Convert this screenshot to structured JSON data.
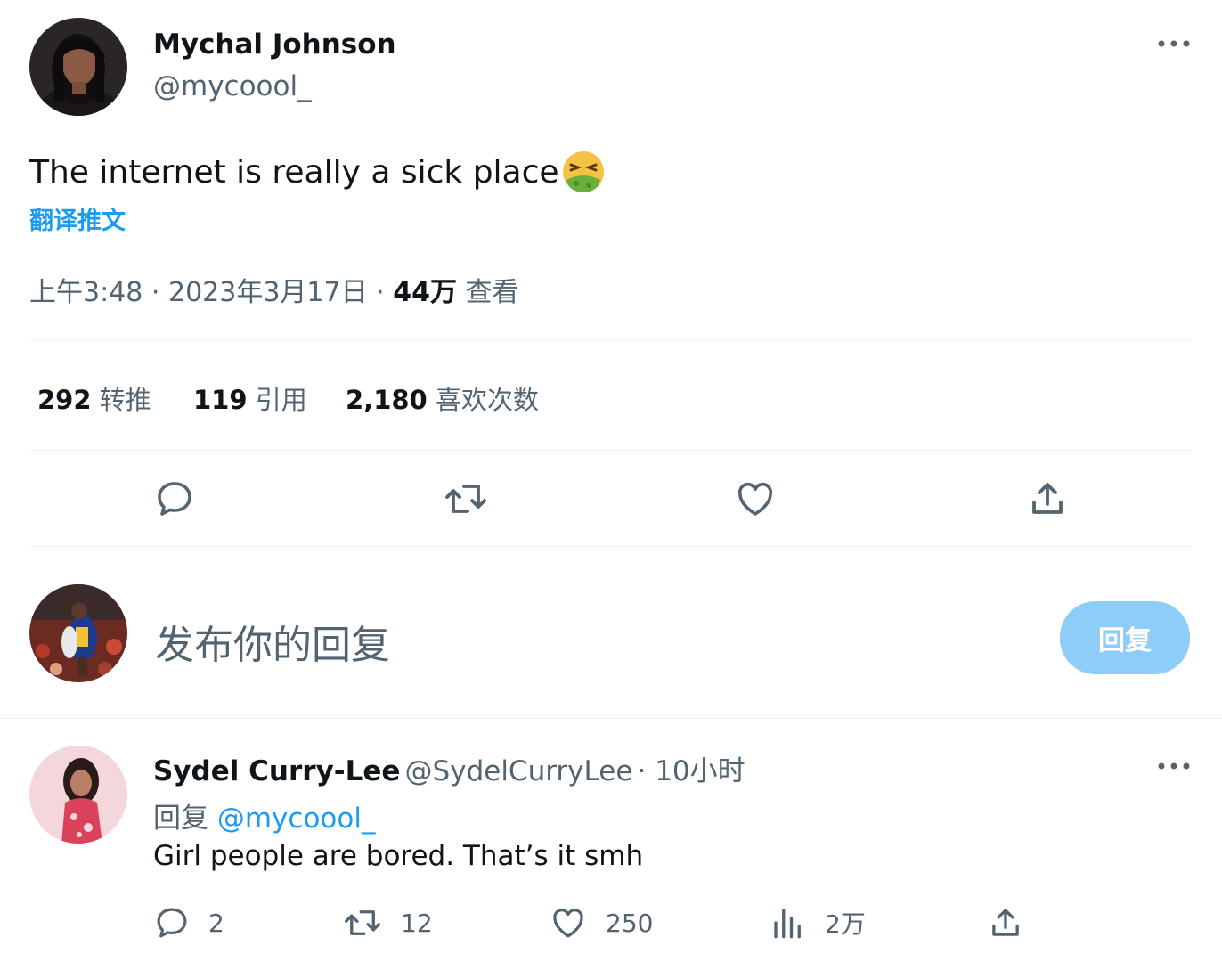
{
  "tweet": {
    "author_name": "Mychal Johnson",
    "author_handle": "@mycoool_",
    "text": "The internet is really a sick place",
    "emoji": "nauseated-face",
    "translate_label": "翻译推文",
    "time": "上午3:48",
    "date": "2023年3月17日",
    "views_count": "44万",
    "views_label": "查看",
    "stats": {
      "retweets_count": "292",
      "retweets_label": "转推",
      "quotes_count": "119",
      "quotes_label": "引用",
      "likes_count": "2,180",
      "likes_label": "喜欢次数"
    },
    "actions": [
      "reply-icon",
      "retweet-icon",
      "like-icon",
      "share-icon"
    ]
  },
  "composer": {
    "placeholder": "发布你的回复",
    "button_label": "回复"
  },
  "reply": {
    "author_name": "Sydel Curry-Lee",
    "author_handle": "@SydelCurryLee",
    "time_ago": "10小时",
    "replying_prefix": "回复",
    "replying_to": "@mycoool_",
    "text": "Girl people are bored. That’s it smh",
    "replies": "2",
    "retweets": "12",
    "likes": "250",
    "views": "2万"
  },
  "colors": {
    "accent": "#1d9bf0",
    "button_disabled": "#8ecdf8",
    "secondary_text": "#536471",
    "divider": "#eff3f4"
  }
}
